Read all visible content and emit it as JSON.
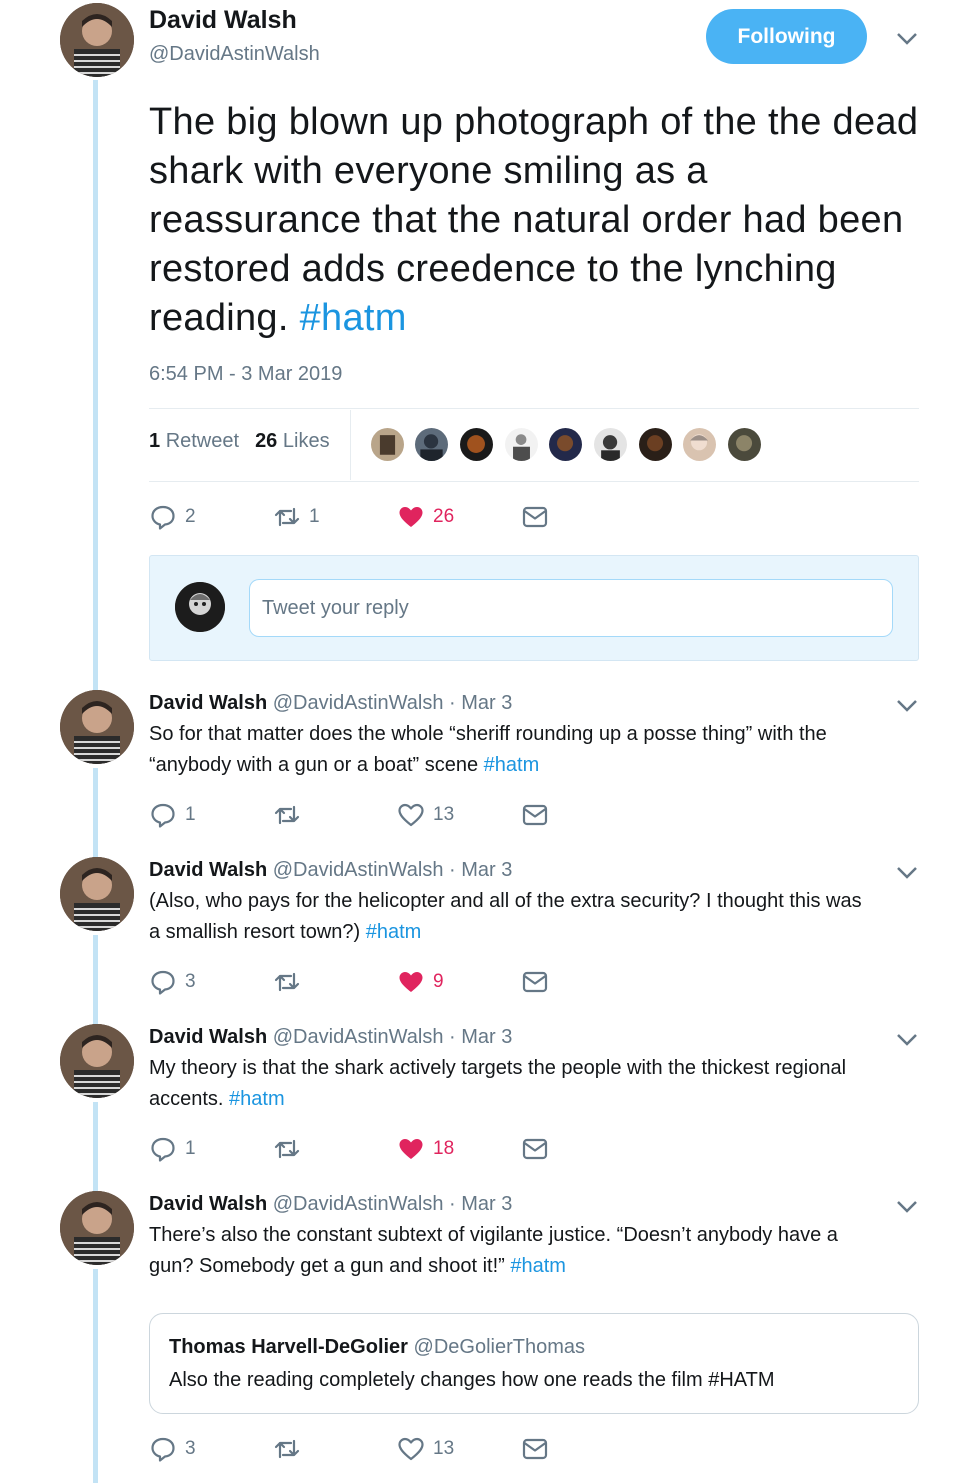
{
  "main_tweet": {
    "author_name": "David Walsh",
    "author_handle": "@DavidAstinWalsh",
    "follow_label": "Following",
    "text": "The big blown up photograph of the the dead shark with everyone smiling as a reassurance that the natural order had been restored adds creedence to the lynching reading.",
    "hashtag": "#hatm",
    "timestamp": "6:54 PM - 3 Mar 2019",
    "retweet_count": "1",
    "retweet_label": "Retweet",
    "like_count": "26",
    "like_label": "Likes",
    "actions": {
      "replies": "2",
      "retweets": "1",
      "likes": "26"
    },
    "liked": true
  },
  "reply_box": {
    "placeholder": "Tweet your reply"
  },
  "replies": [
    {
      "name": "David Walsh",
      "meta": "@DavidAstinWalsh · Mar 3",
      "line1": "So for that matter does the whole “sheriff rounding up a posse thing” with the",
      "line2": "“anybody with a gun or a boat” scene",
      "hashtag": "#hatm",
      "replies": "1",
      "retweets": "",
      "likes": "13",
      "liked": false
    },
    {
      "name": "David Walsh",
      "meta": "@DavidAstinWalsh · Mar 3",
      "line1": "(Also, who pays for the helicopter and all of the extra security? I thought this was",
      "line2": "a smallish resort town?)",
      "hashtag": "#hatm",
      "replies": "3",
      "retweets": "",
      "likes": "9",
      "liked": true
    },
    {
      "name": "David Walsh",
      "meta": "@DavidAstinWalsh · Mar 3",
      "line1": "My theory is that the shark actively targets the people with the thickest regional",
      "line2": "accents.",
      "hashtag": "#hatm",
      "replies": "1",
      "retweets": "",
      "likes": "18",
      "liked": true
    },
    {
      "name": "David Walsh",
      "meta": "@DavidAstinWalsh · Mar 3",
      "line1": "There’s also the constant subtext of vigilante justice. “Doesn’t anybody have a",
      "line2": "gun? Somebody get a gun and shoot it!”",
      "hashtag": "#hatm",
      "replies": "3",
      "retweets": "",
      "likes": "13",
      "liked": false
    }
  ],
  "quoted_tweet": {
    "name": "Thomas Harvell-DeGolier",
    "handle": "@DeGolierThomas",
    "text": "Also the reading completely changes  how one reads the film #HATM"
  },
  "colors": {
    "accent": "#1b95e0",
    "follow_button": "#4ab3f4",
    "like_red": "#e0245e",
    "muted_text": "#657786",
    "thread_line": "#c3e3f5"
  },
  "icons": {
    "reply": "reply-icon",
    "retweet": "retweet-icon",
    "like": "heart-icon",
    "dm": "envelope-icon",
    "caret": "chevron-down-icon"
  }
}
